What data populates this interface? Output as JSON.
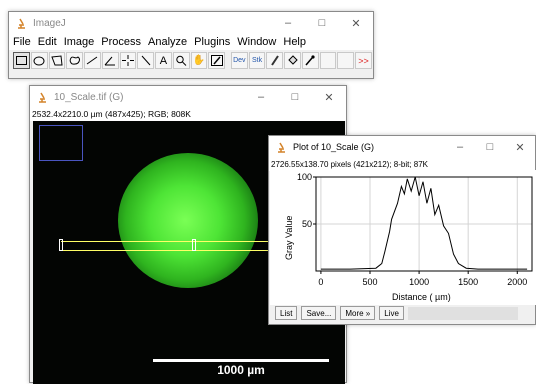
{
  "imagej": {
    "title": "ImageJ",
    "menus": [
      "File",
      "Edit",
      "Image",
      "Process",
      "Analyze",
      "Plugins",
      "Window",
      "Help"
    ],
    "tools": [
      "rectangle",
      "oval",
      "polygon",
      "freehand",
      "line",
      "angle",
      "point",
      "wand",
      "text",
      "magnifier",
      "hand",
      "color-picker",
      "dev",
      "stk",
      "pencil",
      "paintbucket",
      "dropper"
    ],
    "tool_labels": {
      "dev": "Dev",
      "stk": "Stk",
      "more": ">>"
    }
  },
  "image_window": {
    "title": "10_Scale.tif (G)",
    "info": "2532.4x2210.0  µm (487x425); RGB; 808K",
    "scalebar": "1000 µm"
  },
  "plot_window": {
    "title": "Plot of 10_Scale (G)",
    "info": "2726.55x138.70 pixels (421x212); 8-bit; 87K",
    "buttons": [
      "List",
      "Save...",
      "More »",
      "Live"
    ]
  },
  "window_controls": {
    "min": "–",
    "max": "□",
    "close": "✕"
  },
  "chart_data": {
    "type": "line",
    "xlabel": "Distance ( µm)",
    "ylabel": "Gray Value",
    "x_ticks": [
      0,
      500,
      1000,
      1500,
      2000
    ],
    "y_ticks": [
      50,
      100
    ],
    "xlim": [
      -50,
      2150
    ],
    "ylim": [
      0,
      100
    ],
    "grid": true,
    "line_color": "#000000",
    "x": [
      0,
      300,
      560,
      620,
      650,
      700,
      720,
      780,
      820,
      850,
      880,
      920,
      960,
      1000,
      1040,
      1080,
      1120,
      1160,
      1200,
      1250,
      1300,
      1350,
      1400,
      1480,
      1600,
      2000,
      2100
    ],
    "y": [
      2,
      2,
      3,
      8,
      20,
      42,
      55,
      72,
      90,
      82,
      98,
      85,
      100,
      80,
      95,
      72,
      88,
      60,
      70,
      48,
      40,
      18,
      8,
      3,
      2,
      2,
      2
    ]
  }
}
